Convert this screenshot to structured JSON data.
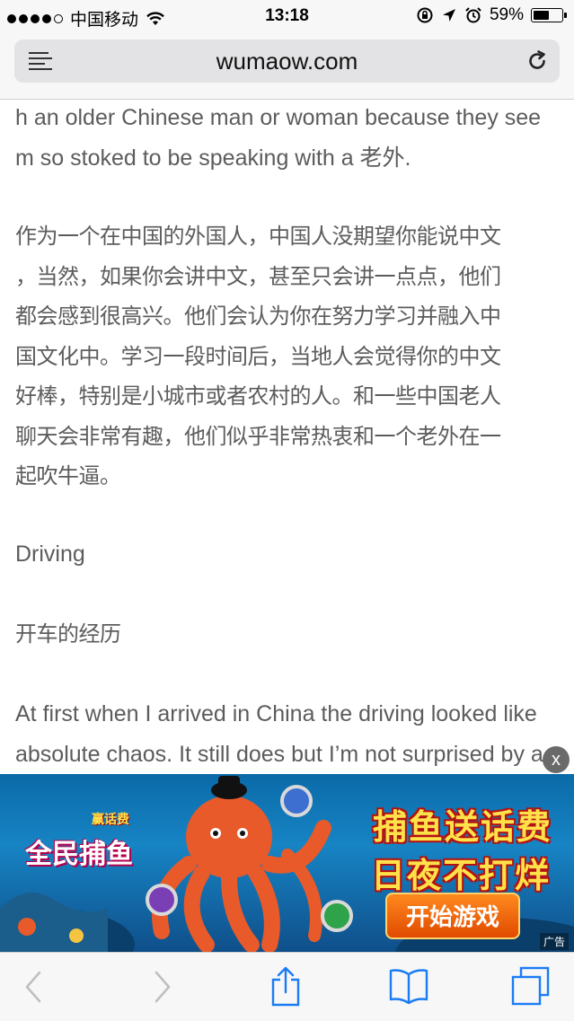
{
  "status_bar": {
    "carrier": "中国移动",
    "time": "13:18",
    "battery_percent": "59%",
    "battery_level": 0.59,
    "signal_bars_filled": 4,
    "signal_bars_total": 5
  },
  "address_bar": {
    "url": "wumaow.com"
  },
  "article": {
    "paragraphs": [
      "h an older Chinese man or woman because they see\nm so stoked to be speaking with a 老外.",
      "作为一个在中国的外国人，中国人没期望你能说中文\n，当然，如果你会讲中文，甚至只会讲一点点，他们\n都会感到很高兴。他们会认为你在努力学习并融入中\n国文化中。学习一段时间后，当地人会觉得你的中文\n好棒，特别是小城市或者农村的人。和一些中国老人\n聊天会非常有趣，他们似乎非常热衷和一个老外在一\n起吹牛逼。",
      "Driving",
      "开车的经历",
      "At first when I arrived in China the driving looked like\nabsolute chaos. It still does but I’m not surprised by a"
    ]
  },
  "ad": {
    "close_label": "x",
    "logo_sub": "赢话费",
    "logo_main": "全民捕鱼",
    "headline_1": "捕鱼送话费",
    "headline_2": "日夜不打烊",
    "button_label": "开始游戏",
    "tag": "广告"
  },
  "bottom_toolbar": {
    "icons": [
      "back-icon",
      "forward-icon",
      "share-icon",
      "bookmarks-icon",
      "tabs-icon"
    ]
  }
}
